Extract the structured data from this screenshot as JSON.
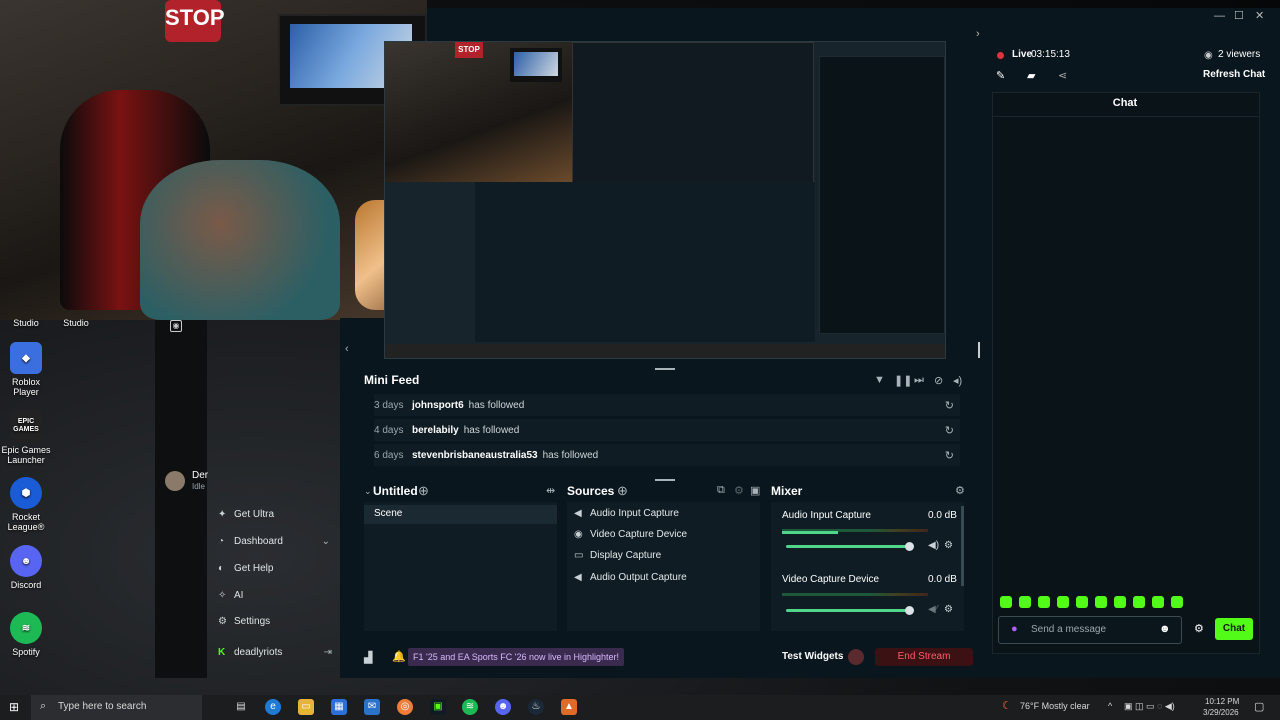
{
  "desktop": {
    "icons": [
      {
        "label": "Studio"
      },
      {
        "label": "Studio"
      },
      {
        "label": "Roblox Player"
      },
      {
        "label": "Epic Games Launcher",
        "badge": "EPIC GAMES"
      },
      {
        "label": "Rocket League®"
      },
      {
        "label": "Discord"
      },
      {
        "label": "Spotify"
      }
    ]
  },
  "webcam": {
    "sign": "STOP"
  },
  "streamlabs": {
    "profile": {
      "name": "Der",
      "status": "Idle"
    },
    "nav": [
      {
        "label": "Get Ultra",
        "icon": "ultra-icon"
      },
      {
        "label": "Dashboard",
        "icon": "dashboard-icon"
      },
      {
        "label": "Get Help",
        "icon": "help-icon"
      },
      {
        "label": "AI",
        "icon": "ai-icon"
      },
      {
        "label": "Settings",
        "icon": "gear-icon"
      },
      {
        "label": "deadlyriots",
        "icon": "kick-icon"
      }
    ],
    "mini_feed": {
      "title": "Mini Feed",
      "rows": [
        {
          "time": "3 days",
          "user": "johnsport6",
          "action": "has followed"
        },
        {
          "time": "4 days",
          "user": "berelabily",
          "action": "has followed"
        },
        {
          "time": "6 days",
          "user": "stevenbrisbaneaustralia53",
          "action": "has followed"
        }
      ]
    },
    "scenes": {
      "title": "Untitled",
      "items": [
        "Scene"
      ]
    },
    "sources": {
      "title": "Sources",
      "items": [
        "Audio Input Capture",
        "Video Capture Device",
        "Display Capture",
        "Audio Output Capture"
      ]
    },
    "mixer": {
      "title": "Mixer",
      "channels": [
        {
          "name": "Audio Input Capture",
          "level": "0.0 dB"
        },
        {
          "name": "Video Capture Device",
          "level": "0.0 dB"
        }
      ]
    },
    "bottom": {
      "banner": "F1 '25 and EA Sports FC '26 now live in Highlighter!",
      "test_widgets": "Test Widgets",
      "end_stream": "End Stream"
    },
    "live": {
      "label": "Live",
      "time": "03:15:13",
      "viewers": "2 viewers",
      "refresh": "Refresh Chat"
    },
    "chat": {
      "title": "Chat",
      "placeholder": "Send a message",
      "send": "Chat"
    }
  },
  "taskbar": {
    "search_placeholder": "Type here to search",
    "weather": "76°F  Mostly clear",
    "time": "10:12 PM",
    "date": "3/29/2026"
  },
  "colors": {
    "accent": "#53fc18",
    "live": "#e0343c",
    "panel": "#09161d"
  }
}
